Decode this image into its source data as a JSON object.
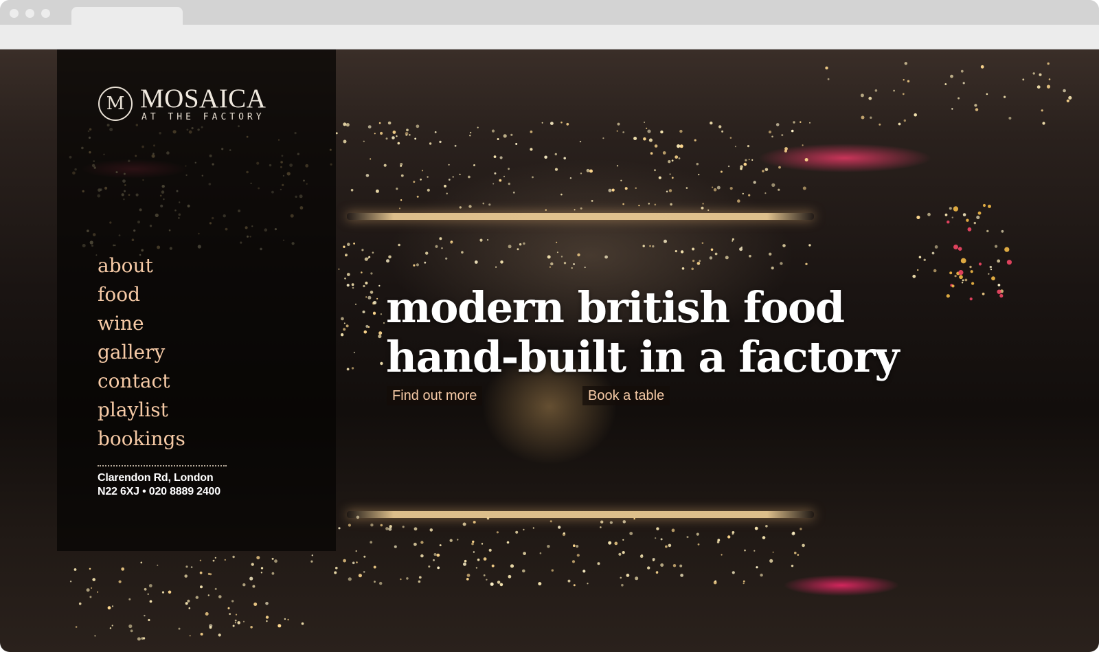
{
  "site": {
    "logo": {
      "emblem": "M",
      "name": "MOSAICA",
      "tagline": "AT THE FACTORY"
    },
    "nav": [
      "about",
      "food",
      "wine",
      "gallery",
      "contact",
      "playlist",
      "bookings"
    ],
    "address": {
      "line1": "Clarendon Rd, London",
      "line2": "N22 6XJ • 020 8889 2400"
    },
    "hero": {
      "line1": "modern british food",
      "line2": "hand-built in a factory",
      "find_out_more": "Find out more",
      "book_a_table": "Book a table"
    }
  },
  "colors": {
    "nav_text": "#f6caa6",
    "sidebar_bg": "rgba(6,4,3,0.72)",
    "hero_text": "#ffffff"
  }
}
